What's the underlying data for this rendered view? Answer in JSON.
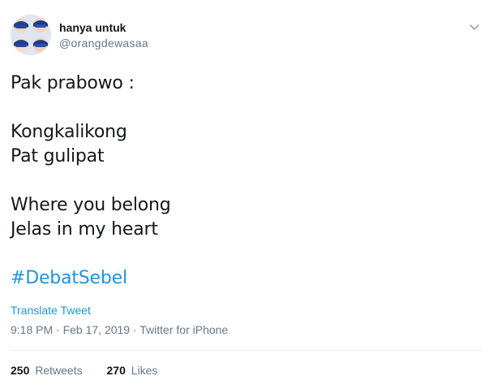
{
  "user": {
    "display_name": "hanya untuk",
    "handle": "@orangdewasaa",
    "avatar_icon": "profile-avatar-icon"
  },
  "tweet": {
    "lines": [
      "Pak prabowo :",
      "",
      "Kongkalikong",
      "Pat gulipat",
      "",
      "Where you belong",
      "Jelas in my heart",
      ""
    ],
    "hashtag": "#DebatSebel"
  },
  "actions": {
    "translate_label": "Translate Tweet",
    "menu_icon": "chevron-down-icon"
  },
  "meta": {
    "text": "9:18 PM · Feb 17, 2019 · Twitter for iPhone"
  },
  "stats": {
    "retweets_count": "250",
    "retweets_label": "Retweets",
    "likes_count": "270",
    "likes_label": "Likes"
  },
  "colors": {
    "link": "#1b95e0",
    "secondary_text": "#657786",
    "primary_text": "#14171a",
    "divider": "#e6ecf0"
  }
}
